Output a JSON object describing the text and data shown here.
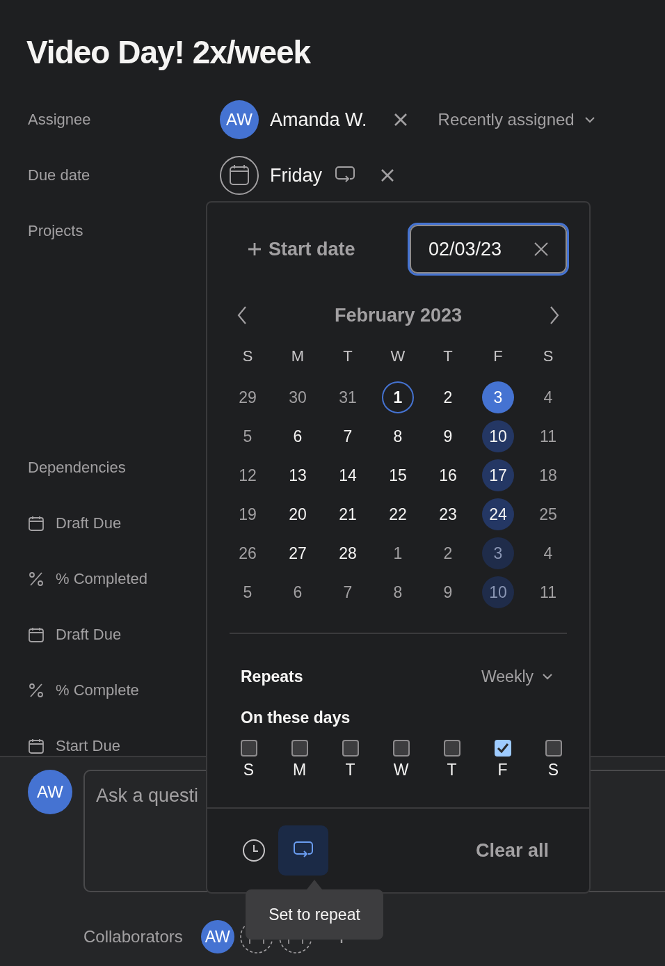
{
  "title": "Video Day! 2x/week",
  "fields": [
    {
      "kind": "assignee",
      "label": "Assignee",
      "avatar": "AW",
      "name": "Amanda W.",
      "dropdown": "Recently assigned"
    },
    {
      "kind": "due_date",
      "label": "Due date",
      "value": "Friday",
      "repeating": true
    },
    {
      "kind": "projects",
      "label": "Projects"
    },
    {
      "kind": "dependencies",
      "label": "Dependencies"
    },
    {
      "kind": "date",
      "label": "Draft Due"
    },
    {
      "kind": "percent",
      "label": "% Completed"
    },
    {
      "kind": "date",
      "label": "Draft Due"
    },
    {
      "kind": "percent",
      "label": "% Complete"
    },
    {
      "kind": "date",
      "label": "Start Due"
    }
  ],
  "comment": {
    "avatar": "AW",
    "placeholder": "Ask a questi"
  },
  "collaborators": {
    "label": "Collaborators",
    "slots": [
      {
        "kind": "avatar",
        "initials": "AW"
      },
      {
        "kind": "empty"
      },
      {
        "kind": "empty"
      }
    ]
  },
  "date_picker": {
    "start_date": "Start date",
    "due_field": "02/03/23",
    "month": "February 2023",
    "weekdays": [
      "S",
      "M",
      "T",
      "W",
      "T",
      "F",
      "S"
    ],
    "weeks": [
      [
        {
          "d": "29",
          "muted": true,
          "kind": "plain"
        },
        {
          "d": "30",
          "muted": true,
          "kind": "plain"
        },
        {
          "d": "31",
          "muted": true,
          "kind": "plain"
        },
        {
          "d": "1",
          "muted": false,
          "kind": "today"
        },
        {
          "d": "2",
          "muted": false,
          "kind": "plain"
        },
        {
          "d": "3",
          "muted": false,
          "kind": "selected"
        },
        {
          "d": "4",
          "muted": true,
          "kind": "plain"
        }
      ],
      [
        {
          "d": "5",
          "muted": true,
          "kind": "plain"
        },
        {
          "d": "6",
          "muted": false,
          "kind": "plain"
        },
        {
          "d": "7",
          "muted": false,
          "kind": "plain"
        },
        {
          "d": "8",
          "muted": false,
          "kind": "plain"
        },
        {
          "d": "9",
          "muted": false,
          "kind": "plain"
        },
        {
          "d": "10",
          "muted": false,
          "kind": "repeat"
        },
        {
          "d": "11",
          "muted": true,
          "kind": "plain"
        }
      ],
      [
        {
          "d": "12",
          "muted": true,
          "kind": "plain"
        },
        {
          "d": "13",
          "muted": false,
          "kind": "plain"
        },
        {
          "d": "14",
          "muted": false,
          "kind": "plain"
        },
        {
          "d": "15",
          "muted": false,
          "kind": "plain"
        },
        {
          "d": "16",
          "muted": false,
          "kind": "plain"
        },
        {
          "d": "17",
          "muted": false,
          "kind": "repeat"
        },
        {
          "d": "18",
          "muted": true,
          "kind": "plain"
        }
      ],
      [
        {
          "d": "19",
          "muted": true,
          "kind": "plain"
        },
        {
          "d": "20",
          "muted": false,
          "kind": "plain"
        },
        {
          "d": "21",
          "muted": false,
          "kind": "plain"
        },
        {
          "d": "22",
          "muted": false,
          "kind": "plain"
        },
        {
          "d": "23",
          "muted": false,
          "kind": "plain"
        },
        {
          "d": "24",
          "muted": false,
          "kind": "repeat"
        },
        {
          "d": "25",
          "muted": true,
          "kind": "plain"
        }
      ],
      [
        {
          "d": "26",
          "muted": true,
          "kind": "plain"
        },
        {
          "d": "27",
          "muted": false,
          "kind": "plain"
        },
        {
          "d": "28",
          "muted": false,
          "kind": "plain"
        },
        {
          "d": "1",
          "muted": true,
          "kind": "plain"
        },
        {
          "d": "2",
          "muted": true,
          "kind": "plain"
        },
        {
          "d": "3",
          "muted": true,
          "kind": "repeat"
        },
        {
          "d": "4",
          "muted": true,
          "kind": "plain"
        }
      ],
      [
        {
          "d": "5",
          "muted": true,
          "kind": "plain"
        },
        {
          "d": "6",
          "muted": true,
          "kind": "plain"
        },
        {
          "d": "7",
          "muted": true,
          "kind": "plain"
        },
        {
          "d": "8",
          "muted": true,
          "kind": "plain"
        },
        {
          "d": "9",
          "muted": true,
          "kind": "plain"
        },
        {
          "d": "10",
          "muted": true,
          "kind": "repeat"
        },
        {
          "d": "11",
          "muted": true,
          "kind": "plain"
        }
      ]
    ],
    "repeats_label": "Repeats",
    "frequency": "Weekly",
    "days_label": "On these days",
    "days": [
      {
        "label": "S",
        "checked": false
      },
      {
        "label": "M",
        "checked": false
      },
      {
        "label": "T",
        "checked": false
      },
      {
        "label": "W",
        "checked": false
      },
      {
        "label": "T",
        "checked": false
      },
      {
        "label": "F",
        "checked": true
      },
      {
        "label": "S",
        "checked": false
      }
    ],
    "repeat_selected": true,
    "clear": "Clear all"
  },
  "tooltip": "Set to repeat"
}
